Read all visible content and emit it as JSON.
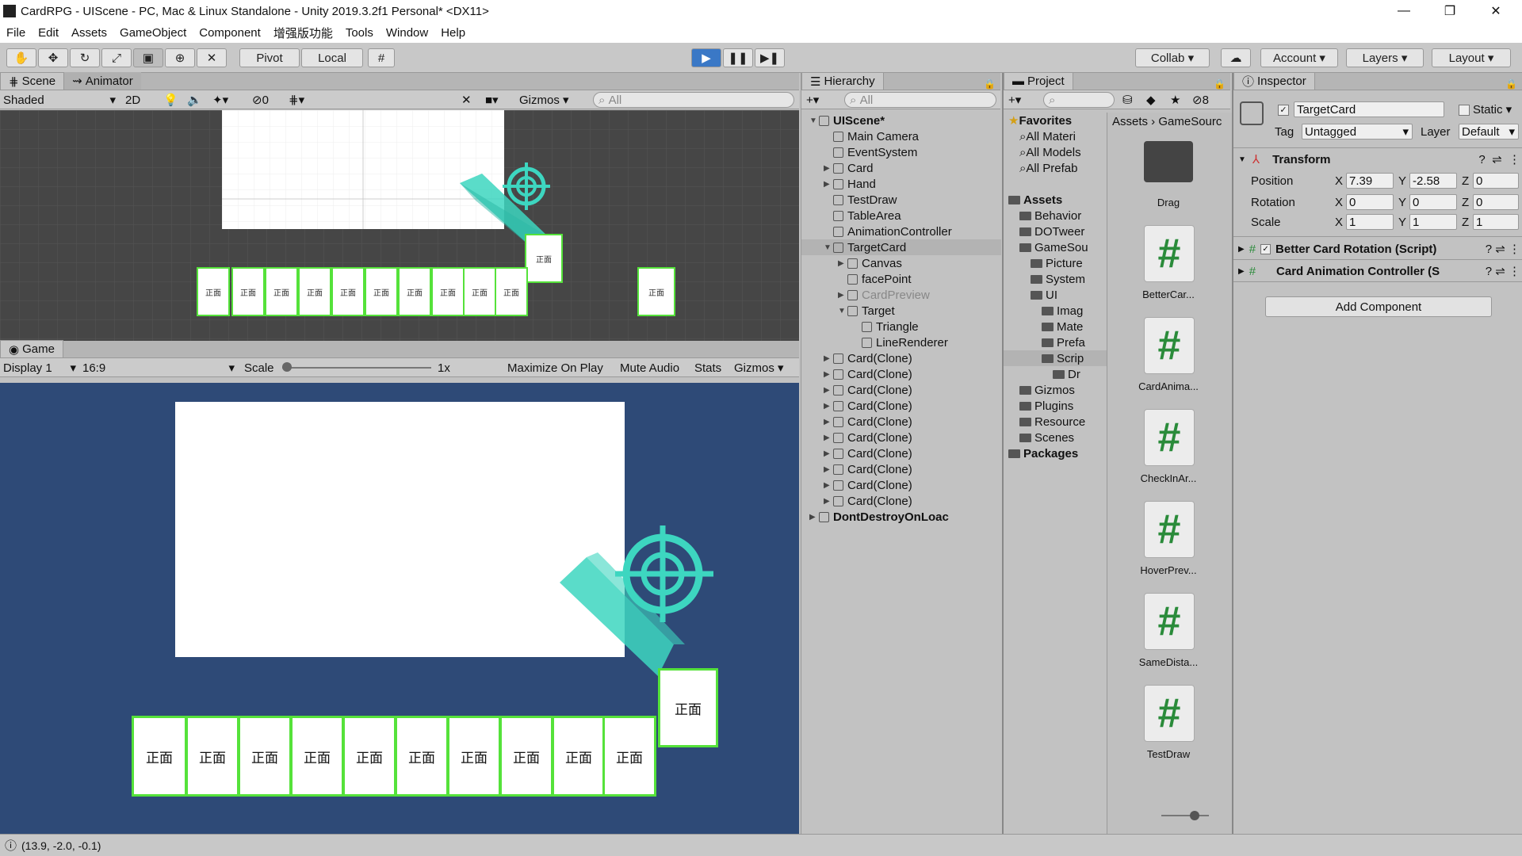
{
  "window": {
    "title": "CardRPG - UIScene - PC, Mac & Linux Standalone - Unity 2019.3.2f1 Personal* <DX11>"
  },
  "menu": [
    "File",
    "Edit",
    "Assets",
    "GameObject",
    "Component",
    "增强版功能",
    "Tools",
    "Window",
    "Help"
  ],
  "toolbar": {
    "pivot": "Pivot",
    "local": "Local",
    "collab": "Collab",
    "account": "Account",
    "layers": "Layers",
    "layout": "Layout"
  },
  "scene": {
    "tab_scene": "Scene",
    "tab_animator": "Animator",
    "shading": "Shaded",
    "mode2d": "2D",
    "hidden_count": "0",
    "gizmos": "Gizmos",
    "search_placeholder": "All",
    "card_text": "正面"
  },
  "game": {
    "tab": "Game",
    "display": "Display 1",
    "aspect": "16:9",
    "scale_label": "Scale",
    "scale_value": "1x",
    "maximize": "Maximize On Play",
    "mute": "Mute Audio",
    "stats": "Stats",
    "gizmos": "Gizmos",
    "card_text": "正面"
  },
  "hierarchy": {
    "tab": "Hierarchy",
    "search_placeholder": "All",
    "rows": [
      {
        "label": "UIScene*",
        "depth": 0,
        "arrow": "▼"
      },
      {
        "label": "Main Camera",
        "depth": 1,
        "arrow": ""
      },
      {
        "label": "EventSystem",
        "depth": 1,
        "arrow": ""
      },
      {
        "label": "Card",
        "depth": 1,
        "arrow": "▶"
      },
      {
        "label": "Hand",
        "depth": 1,
        "arrow": "▶"
      },
      {
        "label": "TestDraw",
        "depth": 1,
        "arrow": ""
      },
      {
        "label": "TableArea",
        "depth": 1,
        "arrow": ""
      },
      {
        "label": "AnimationController",
        "depth": 1,
        "arrow": ""
      },
      {
        "label": "TargetCard",
        "depth": 1,
        "arrow": "▼"
      },
      {
        "label": "Canvas",
        "depth": 2,
        "arrow": "▶"
      },
      {
        "label": "facePoint",
        "depth": 2,
        "arrow": ""
      },
      {
        "label": "CardPreview",
        "depth": 2,
        "arrow": "▶"
      },
      {
        "label": "Target",
        "depth": 2,
        "arrow": "▼"
      },
      {
        "label": "Triangle",
        "depth": 3,
        "arrow": ""
      },
      {
        "label": "LineRenderer",
        "depth": 3,
        "arrow": ""
      },
      {
        "label": "Card(Clone)",
        "depth": 1,
        "arrow": "▶"
      },
      {
        "label": "Card(Clone)",
        "depth": 1,
        "arrow": "▶"
      },
      {
        "label": "Card(Clone)",
        "depth": 1,
        "arrow": "▶"
      },
      {
        "label": "Card(Clone)",
        "depth": 1,
        "arrow": "▶"
      },
      {
        "label": "Card(Clone)",
        "depth": 1,
        "arrow": "▶"
      },
      {
        "label": "Card(Clone)",
        "depth": 1,
        "arrow": "▶"
      },
      {
        "label": "Card(Clone)",
        "depth": 1,
        "arrow": "▶"
      },
      {
        "label": "Card(Clone)",
        "depth": 1,
        "arrow": "▶"
      },
      {
        "label": "Card(Clone)",
        "depth": 1,
        "arrow": "▶"
      },
      {
        "label": "Card(Clone)",
        "depth": 1,
        "arrow": "▶"
      },
      {
        "label": "DontDestroyOnLoac",
        "depth": 0,
        "arrow": "▶"
      }
    ]
  },
  "project": {
    "tab": "Project",
    "hidden_count": "8",
    "breadcrumb": [
      "Assets",
      "GameSourc"
    ],
    "tree": [
      {
        "label": "Favorites",
        "depth": 0,
        "type": "star",
        "bold": true
      },
      {
        "label": "All Materi",
        "depth": 1,
        "type": "search"
      },
      {
        "label": "All Models",
        "depth": 1,
        "type": "search"
      },
      {
        "label": "All Prefab",
        "depth": 1,
        "type": "search"
      },
      {
        "label": "",
        "depth": 0,
        "type": "spacer"
      },
      {
        "label": "Assets",
        "depth": 0,
        "type": "folder",
        "bold": true
      },
      {
        "label": "Behavior",
        "depth": 1,
        "type": "folder"
      },
      {
        "label": "DOTweer",
        "depth": 1,
        "type": "folder"
      },
      {
        "label": "GameSou",
        "depth": 1,
        "type": "folder"
      },
      {
        "label": "Picture",
        "depth": 2,
        "type": "folder"
      },
      {
        "label": "System",
        "depth": 2,
        "type": "folder"
      },
      {
        "label": "UI",
        "depth": 2,
        "type": "folder"
      },
      {
        "label": "Imag",
        "depth": 3,
        "type": "folder"
      },
      {
        "label": "Mate",
        "depth": 3,
        "type": "folder"
      },
      {
        "label": "Prefa",
        "depth": 3,
        "type": "folder"
      },
      {
        "label": "Scrip",
        "depth": 3,
        "type": "folder"
      },
      {
        "label": "Dr",
        "depth": 4,
        "type": "folder"
      },
      {
        "label": "Gizmos",
        "depth": 1,
        "type": "folder"
      },
      {
        "label": "Plugins",
        "depth": 1,
        "type": "folder"
      },
      {
        "label": "Resource",
        "depth": 1,
        "type": "folder"
      },
      {
        "label": "Scenes",
        "depth": 1,
        "type": "folder"
      },
      {
        "label": "Packages",
        "depth": 0,
        "type": "folder",
        "bold": true
      }
    ],
    "assets": [
      {
        "label": "Drag",
        "kind": "folder"
      },
      {
        "label": "BetterCar...",
        "kind": "script"
      },
      {
        "label": "CardAnima...",
        "kind": "script"
      },
      {
        "label": "CheckInAr...",
        "kind": "script"
      },
      {
        "label": "HoverPrev...",
        "kind": "script"
      },
      {
        "label": "SameDista...",
        "kind": "script"
      },
      {
        "label": "TestDraw",
        "kind": "script"
      }
    ]
  },
  "inspector": {
    "tab": "Inspector",
    "object_name": "TargetCard",
    "static": "Static",
    "tag_label": "Tag",
    "tag_value": "Untagged",
    "layer_label": "Layer",
    "layer_value": "Default",
    "transform": "Transform",
    "position_label": "Position",
    "rotation_label": "Rotation",
    "scale_label": "Scale",
    "position": {
      "x": "7.39",
      "y": "-2.58",
      "z": "0"
    },
    "rotation": {
      "x": "0",
      "y": "0",
      "z": "0"
    },
    "scale": {
      "x": "1",
      "y": "1",
      "z": "1"
    },
    "components": [
      "Better Card Rotation (Script)",
      "Card Animation Controller (S"
    ],
    "add_component": "Add Component"
  },
  "status": {
    "coords": "(13.9, -2.0, -0.1)"
  },
  "colors": {
    "game_bg": "#2e4a77",
    "accent": "#3dd6c0",
    "card_border": "#55e23a",
    "play_active": "#3a78c6"
  }
}
